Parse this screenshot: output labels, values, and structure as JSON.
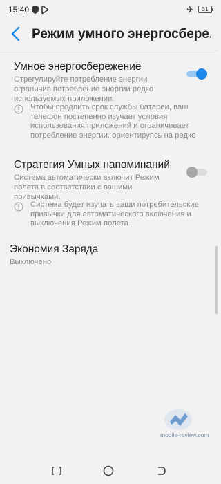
{
  "status_bar": {
    "time": "15:40",
    "battery": "31"
  },
  "app_bar": {
    "title": "Режим умного энергосбере..."
  },
  "settings": [
    {
      "title": "Умное энергосбережение",
      "description": "Отрегулируйте потребление энергии ограничив потребление энергии редко используемых приложении.",
      "note": "Чтобы продлить срок службы батареи, ваш телефон постепенно изучает условия использования приложений и ограничивает потребление энергии, ориентируясь на редко",
      "enabled": true
    },
    {
      "title": "Стратегия Умных напоминаний",
      "description": "Система автоматически включит Режим полета в соответствии с вашими привычками.",
      "note": "Система будет изучать ваши потребительские привычки для автоматического включения и выключения Режим полета",
      "enabled": false
    },
    {
      "title": "Экономия Заряда",
      "description": "Выключено"
    }
  ],
  "watermark": "mobile-review.com",
  "colors": {
    "accent": "#1c88ea",
    "accent_track": "#9cc9f2",
    "background": "#f2f2f2"
  }
}
